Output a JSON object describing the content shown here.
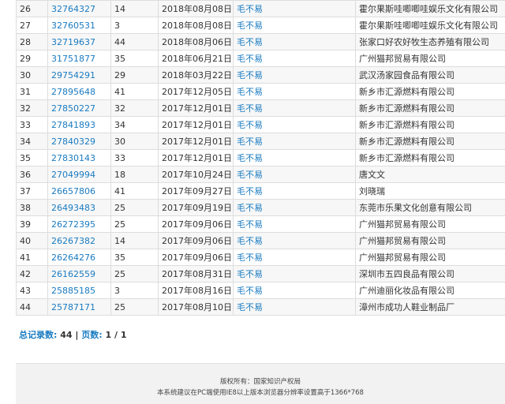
{
  "rows": [
    {
      "index": "26",
      "reg_no": "32764327",
      "class": "14",
      "date": "2018年08月08日",
      "status": "毛不易",
      "applicant": "霍尔果斯哇唧唧哇娱乐文化有限公司"
    },
    {
      "index": "27",
      "reg_no": "32760531",
      "class": "3",
      "date": "2018年08月08日",
      "status": "毛不易",
      "applicant": "霍尔果斯哇唧唧哇娱乐文化有限公司"
    },
    {
      "index": "28",
      "reg_no": "32719637",
      "class": "44",
      "date": "2018年08月06日",
      "status": "毛不易",
      "applicant": "张家口好农好牧生态养殖有限公司"
    },
    {
      "index": "29",
      "reg_no": "31751877",
      "class": "35",
      "date": "2018年06月21日",
      "status": "毛不易",
      "applicant": "广州猫邦贸易有限公司"
    },
    {
      "index": "30",
      "reg_no": "29754291",
      "class": "29",
      "date": "2018年03月22日",
      "status": "毛不易",
      "applicant": "武汉汤家园食品有限公司"
    },
    {
      "index": "31",
      "reg_no": "27895648",
      "class": "41",
      "date": "2017年12月05日",
      "status": "毛不易",
      "applicant": "新乡市汇源燃料有限公司"
    },
    {
      "index": "32",
      "reg_no": "27850227",
      "class": "32",
      "date": "2017年12月01日",
      "status": "毛不易",
      "applicant": "新乡市汇源燃料有限公司"
    },
    {
      "index": "33",
      "reg_no": "27841893",
      "class": "34",
      "date": "2017年12月01日",
      "status": "毛不易",
      "applicant": "新乡市汇源燃料有限公司"
    },
    {
      "index": "34",
      "reg_no": "27840329",
      "class": "30",
      "date": "2017年12月01日",
      "status": "毛不易",
      "applicant": "新乡市汇源燃料有限公司"
    },
    {
      "index": "35",
      "reg_no": "27830143",
      "class": "33",
      "date": "2017年12月01日",
      "status": "毛不易",
      "applicant": "新乡市汇源燃料有限公司"
    },
    {
      "index": "36",
      "reg_no": "27049994",
      "class": "18",
      "date": "2017年10月24日",
      "status": "毛不易",
      "applicant": "唐文文"
    },
    {
      "index": "37",
      "reg_no": "26657806",
      "class": "41",
      "date": "2017年09月27日",
      "status": "毛不易",
      "applicant": "刘晓瑞"
    },
    {
      "index": "38",
      "reg_no": "26493483",
      "class": "25",
      "date": "2017年09月19日",
      "status": "毛不易",
      "applicant": "东莞市乐果文化创意有限公司"
    },
    {
      "index": "39",
      "reg_no": "26272395",
      "class": "25",
      "date": "2017年09月06日",
      "status": "毛不易",
      "applicant": "广州猫邦贸易有限公司"
    },
    {
      "index": "40",
      "reg_no": "26267382",
      "class": "14",
      "date": "2017年09月06日",
      "status": "毛不易",
      "applicant": "广州猫邦贸易有限公司"
    },
    {
      "index": "41",
      "reg_no": "26264276",
      "class": "35",
      "date": "2017年09月06日",
      "status": "毛不易",
      "applicant": "广州猫邦贸易有限公司"
    },
    {
      "index": "42",
      "reg_no": "26162559",
      "class": "25",
      "date": "2017年08月31日",
      "status": "毛不易",
      "applicant": "深圳市五四良品有限公司"
    },
    {
      "index": "43",
      "reg_no": "25885185",
      "class": "3",
      "date": "2017年08月16日",
      "status": "毛不易",
      "applicant": "广州迪丽化妆品有限公司"
    },
    {
      "index": "44",
      "reg_no": "25787171",
      "class": "25",
      "date": "2017年08月10日",
      "status": "毛不易",
      "applicant": "漳州市成功人鞋业制品厂"
    }
  ],
  "summary": {
    "total_label": "总记录数:",
    "total_value": "44",
    "separator": "|",
    "pages_label": "页数:",
    "pages_value": "1 / 1"
  },
  "footer": {
    "copyright": "版权所有：国家知识产权局",
    "browser_note": "本系统建议在PC端使用IE8以上版本浏览器分辨率设置高于1366*768"
  },
  "colors": {
    "link": "#1a7bc1",
    "row_alt": "#f7f7f7",
    "footer_bg": "#f2f2f2"
  }
}
